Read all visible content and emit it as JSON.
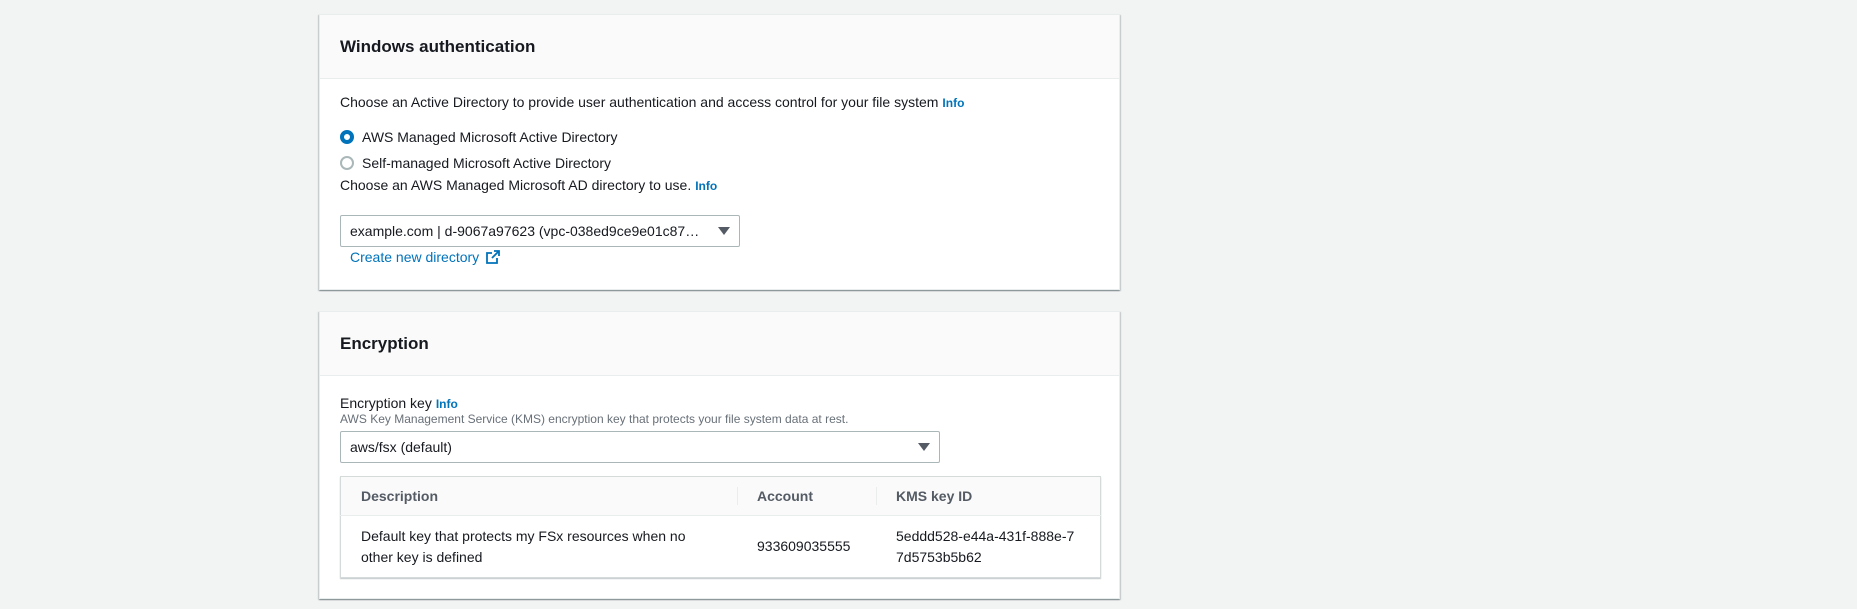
{
  "windows_auth": {
    "title": "Windows authentication",
    "intro": "Choose an Active Directory to provide user authentication and access control for your file system",
    "intro_info": "Info",
    "radio_options": [
      {
        "label": "AWS Managed Microsoft Active Directory",
        "selected": true
      },
      {
        "label": "Self-managed Microsoft Active Directory",
        "selected": false
      }
    ],
    "directory_label": "Choose an AWS Managed Microsoft AD directory to use.",
    "directory_info": "Info",
    "directory_selected": "example.com | d-9067a97623 (vpc-038ed9ce9e01c87…",
    "create_link": "Create new directory"
  },
  "encryption": {
    "title": "Encryption",
    "key_label": "Encryption key",
    "key_info": "Info",
    "key_description": "AWS Key Management Service (KMS) encryption key that protects your file system data at rest.",
    "key_selected": "aws/fsx (default)",
    "table": {
      "headers": [
        "Description",
        "Account",
        "KMS key ID"
      ],
      "rows": [
        [
          "Default key that protects my FSx resources when no other key is defined",
          "933609035555",
          "5eddd528-e44a-431f-888e-77d5753b5b62"
        ]
      ]
    }
  },
  "colors": {
    "accent": "#0073bb",
    "background": "#f2f3f3",
    "text": "#16191f"
  }
}
